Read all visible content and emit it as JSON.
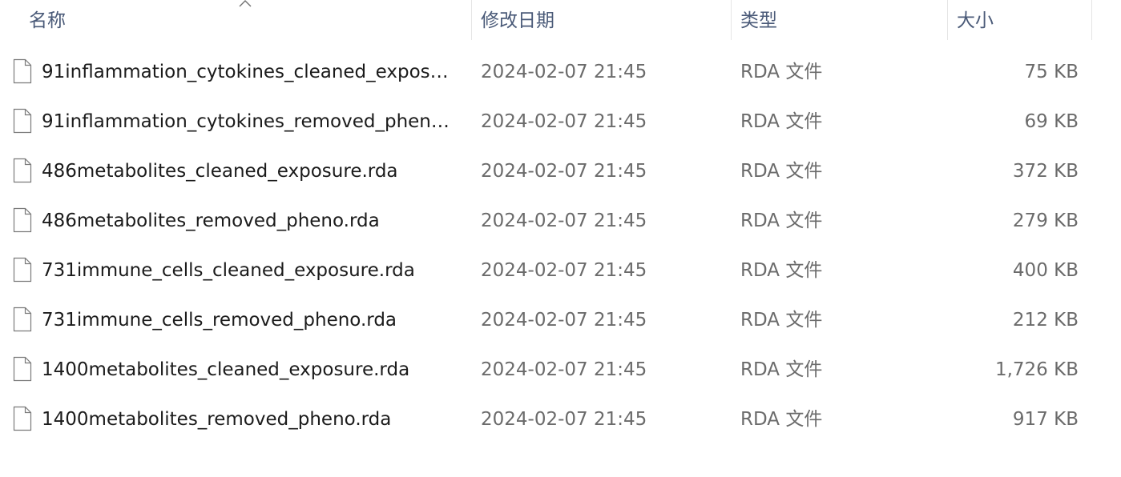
{
  "columns": {
    "name": "名称",
    "date": "修改日期",
    "type": "类型",
    "size": "大小"
  },
  "sort": {
    "column": "name",
    "direction": "ascending",
    "icon": "chevron-up-icon"
  },
  "file_icon": "blank-document-icon",
  "files": [
    {
      "name": "91inflammation_cytokines_cleaned_exposur...",
      "date": "2024-02-07 21:45",
      "type": "RDA 文件",
      "size": "75 KB"
    },
    {
      "name": "91inflammation_cytokines_removed_pheno....",
      "date": "2024-02-07 21:45",
      "type": "RDA 文件",
      "size": "69 KB"
    },
    {
      "name": "486metabolites_cleaned_exposure.rda",
      "date": "2024-02-07 21:45",
      "type": "RDA 文件",
      "size": "372 KB"
    },
    {
      "name": "486metabolites_removed_pheno.rda",
      "date": "2024-02-07 21:45",
      "type": "RDA 文件",
      "size": "279 KB"
    },
    {
      "name": "731immune_cells_cleaned_exposure.rda",
      "date": "2024-02-07 21:45",
      "type": "RDA 文件",
      "size": "400 KB"
    },
    {
      "name": "731immune_cells_removed_pheno.rda",
      "date": "2024-02-07 21:45",
      "type": "RDA 文件",
      "size": "212 KB"
    },
    {
      "name": "1400metabolites_cleaned_exposure.rda",
      "date": "2024-02-07 21:45",
      "type": "RDA 文件",
      "size": "1,726 KB"
    },
    {
      "name": "1400metabolites_removed_pheno.rda",
      "date": "2024-02-07 21:45",
      "type": "RDA 文件",
      "size": "917 KB"
    }
  ]
}
